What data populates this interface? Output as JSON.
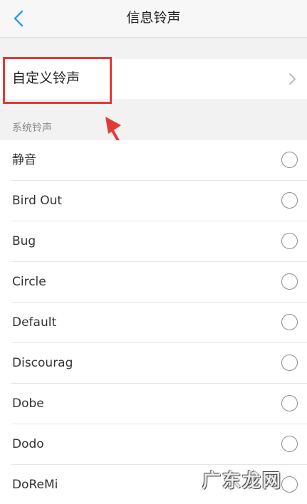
{
  "header": {
    "title": "信息铃声"
  },
  "custom": {
    "label": "自定义铃声"
  },
  "section": {
    "title": "系统铃声"
  },
  "ringtones": [
    "静音",
    "Bird Out",
    "Bug",
    "Circle",
    "Default",
    "Discourag",
    "Dobe",
    "Dodo",
    "DoReMi"
  ],
  "watermark": {
    "text": "广东龙网"
  },
  "colors": {
    "accent": "#2a9df4",
    "highlight": "#e53935"
  },
  "icons": {
    "back": "chevron-left-icon",
    "forward": "chevron-right-icon",
    "radio": "radio-unchecked-icon"
  }
}
